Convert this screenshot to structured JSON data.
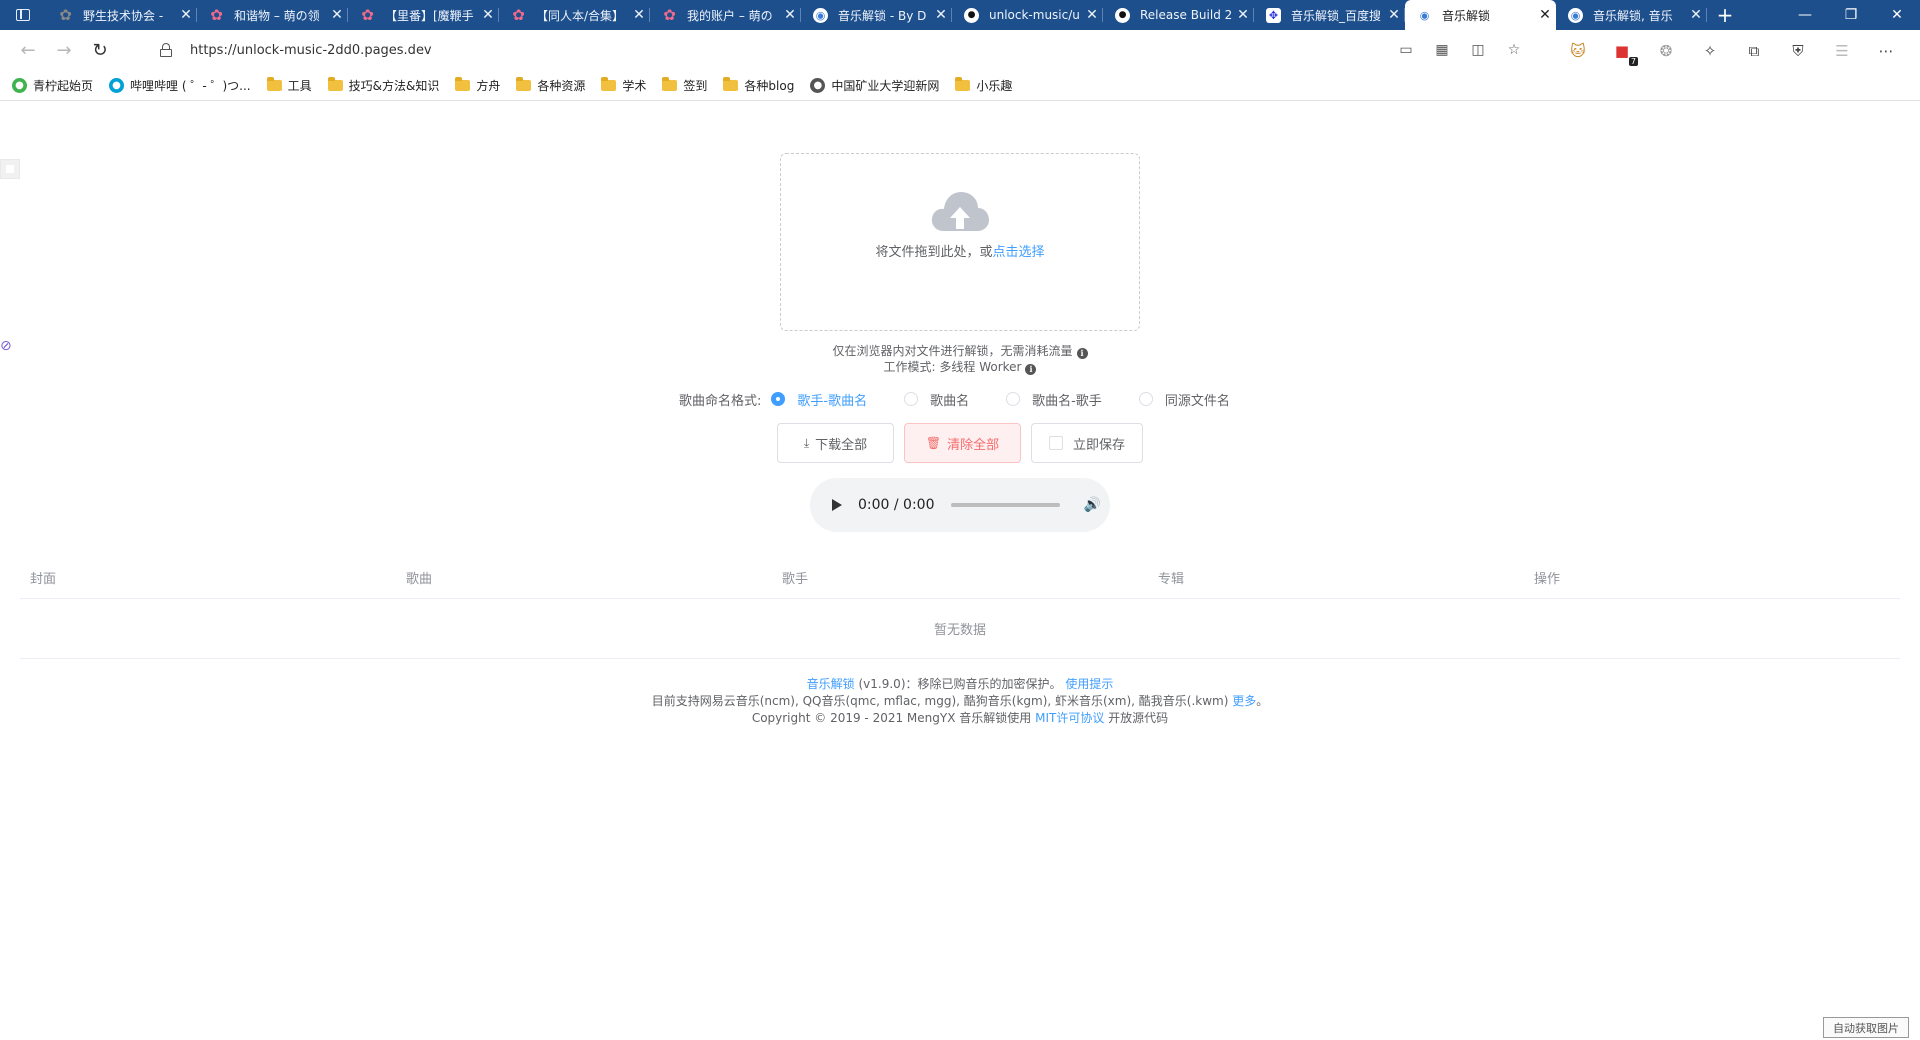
{
  "tabs": [
    {
      "title": "野生技术协会 -",
      "icon": "sakura-icon",
      "color": "#888888",
      "active": false
    },
    {
      "title": "和谐物 – 萌の领",
      "icon": "sakura-icon",
      "color": "#f06a8b",
      "active": false
    },
    {
      "title": "【里番】[魔鞭⼿",
      "icon": "sakura-icon",
      "color": "#f06a8b",
      "active": false
    },
    {
      "title": "【同人本/合集】",
      "icon": "sakura-icon",
      "color": "#f06a8b",
      "active": false
    },
    {
      "title": "我的账户 – 萌の",
      "icon": "sakura-icon",
      "color": "#f06a8b",
      "active": false
    },
    {
      "title": "音乐解锁 - By D",
      "icon": "globe-icon",
      "color": "#ffffff",
      "active": false
    },
    {
      "title": "unlock-music/u",
      "icon": "github-icon",
      "color": "#ffffff",
      "active": false
    },
    {
      "title": "Release Build 2(",
      "icon": "github-icon",
      "color": "#ffffff",
      "active": false
    },
    {
      "title": "音乐解锁_百度搜",
      "icon": "baidu-icon",
      "color": "#ffffff",
      "active": false
    },
    {
      "title": "音乐解锁",
      "icon": "globe-icon",
      "color": "#3a7bd5",
      "active": true
    },
    {
      "title": "音乐解锁, 音乐",
      "icon": "globe-icon",
      "color": "#ffffff",
      "active": false
    }
  ],
  "address": {
    "url": "https://unlock-music-2dd0.pages.dev"
  },
  "bookmarks": [
    {
      "label": "青柠起始页",
      "type": "site",
      "color": "#3fb34f"
    },
    {
      "label": "哔哩哔哩 ( ゜- ゜)つ...",
      "type": "site",
      "color": "#00a1d6"
    },
    {
      "label": "工具",
      "type": "folder"
    },
    {
      "label": "技巧&方法&知识",
      "type": "folder"
    },
    {
      "label": "方舟",
      "type": "folder"
    },
    {
      "label": "各种资源",
      "type": "folder"
    },
    {
      "label": "学术",
      "type": "folder"
    },
    {
      "label": "签到",
      "type": "folder"
    },
    {
      "label": "各种blog",
      "type": "folder"
    },
    {
      "label": "中国矿业大学迎新网",
      "type": "site",
      "color": "#555555"
    },
    {
      "label": "小乐趣",
      "type": "folder"
    }
  ],
  "extension_badge": "7",
  "upload": {
    "text": "将文件拖到此处，或",
    "link": "点击选择"
  },
  "hints": {
    "line1": "仅在浏览器内对文件进行解锁，无需消耗流量",
    "line2": "工作模式: 多线程 Worker"
  },
  "naming": {
    "label": "歌曲命名格式:",
    "options": [
      "歌手-歌曲名",
      "歌曲名",
      "歌曲名-歌手",
      "同源文件名"
    ],
    "selected": 0
  },
  "buttons": {
    "download_all": "下载全部",
    "clear_all": "清除全部",
    "save_now": "立即保存"
  },
  "player": {
    "time": "0:00 / 0:00"
  },
  "table": {
    "columns": [
      "封面",
      "歌曲",
      "歌手",
      "专辑",
      "操作"
    ],
    "empty_text": "暂无数据"
  },
  "footer": {
    "app_link": "音乐解锁",
    "line1_rest": "(v1.9.0)：移除已购音乐的加密保护。",
    "usage_link": "使用提示",
    "line2": "目前支持网易云音乐(ncm), QQ音乐(qmc, mflac, mgg), 酷狗音乐(kgm), 虾米音乐(xm), 酷我音乐(.kwm)",
    "more_link": "更多",
    "line2_end": "。",
    "line3_start": "Copyright © 2019 - 2021 MengYX 音乐解锁使用",
    "license_link": "MIT许可协议",
    "line3_end": "开放源代码"
  },
  "corner_button": "自动获取图片"
}
